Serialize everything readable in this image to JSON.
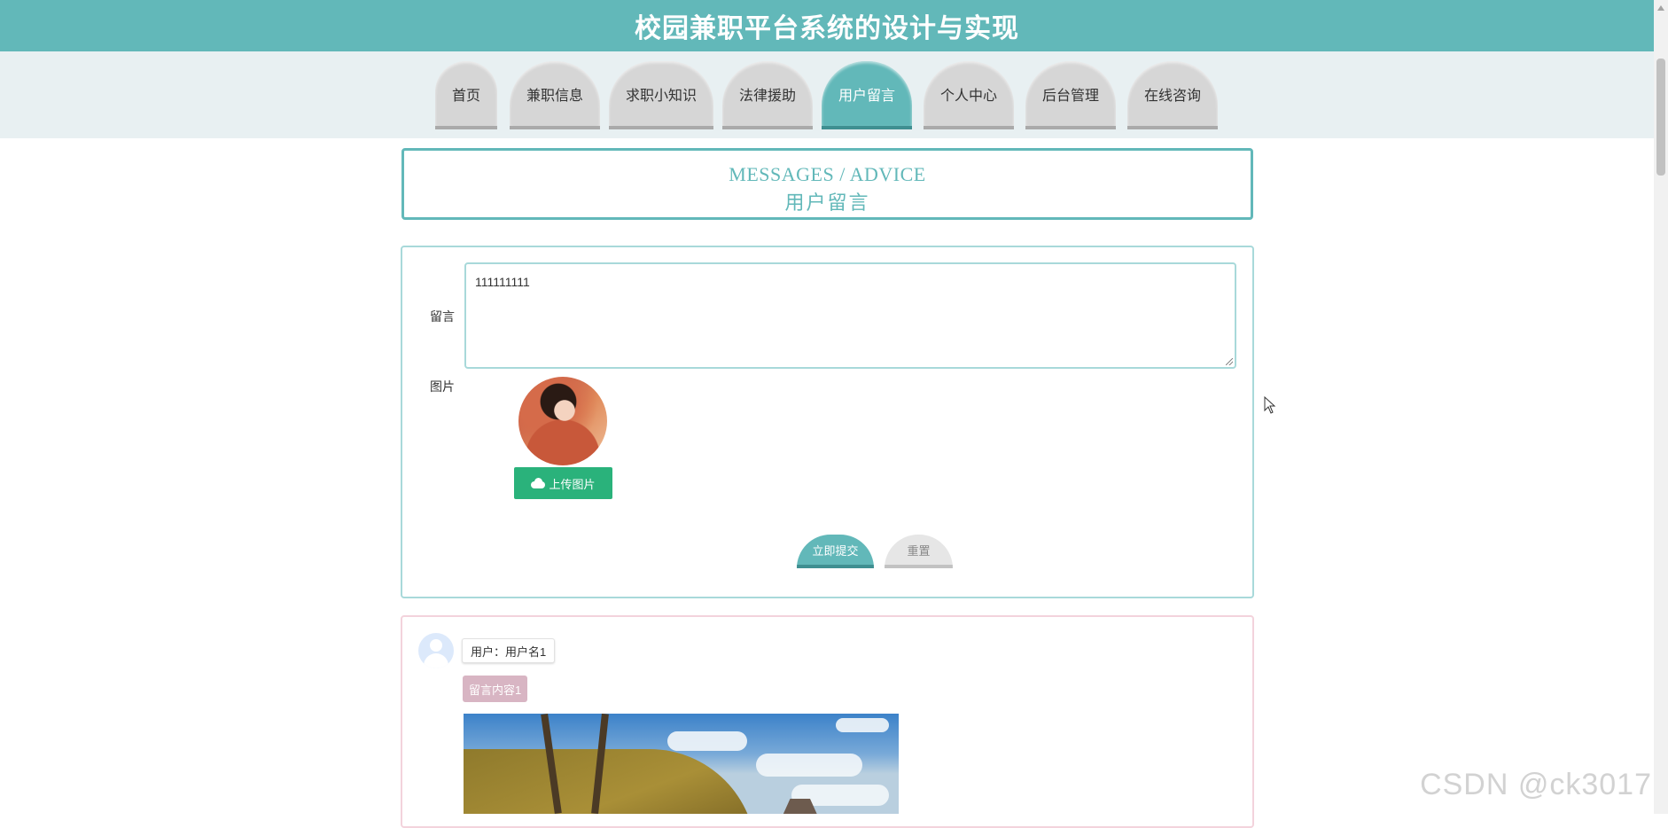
{
  "header": {
    "title": "校园兼职平台系统的设计与实现"
  },
  "nav": {
    "tabs": [
      {
        "label": "首页",
        "active": false
      },
      {
        "label": "兼职信息",
        "active": false
      },
      {
        "label": "求职小知识",
        "active": false
      },
      {
        "label": "法律援助",
        "active": false
      },
      {
        "label": "用户留言",
        "active": true
      },
      {
        "label": "个人中心",
        "active": false
      },
      {
        "label": "后台管理",
        "active": false
      },
      {
        "label": "在线咨询",
        "active": false
      }
    ]
  },
  "section": {
    "title_en": "MESSAGES / ADVICE",
    "title_cn": "用户留言"
  },
  "form": {
    "message_label": "留言",
    "message_value": "111111111",
    "image_label": "图片",
    "upload_label": "上传图片",
    "submit_label": "立即提交",
    "reset_label": "重置"
  },
  "messages": [
    {
      "user": "用户：用户名1",
      "content": "留言内容1"
    }
  ],
  "watermark": "CSDN @ck3017",
  "colors": {
    "accent": "#62b8b9",
    "upload": "#2ab27b",
    "content_chip": "#d8b5c3"
  }
}
